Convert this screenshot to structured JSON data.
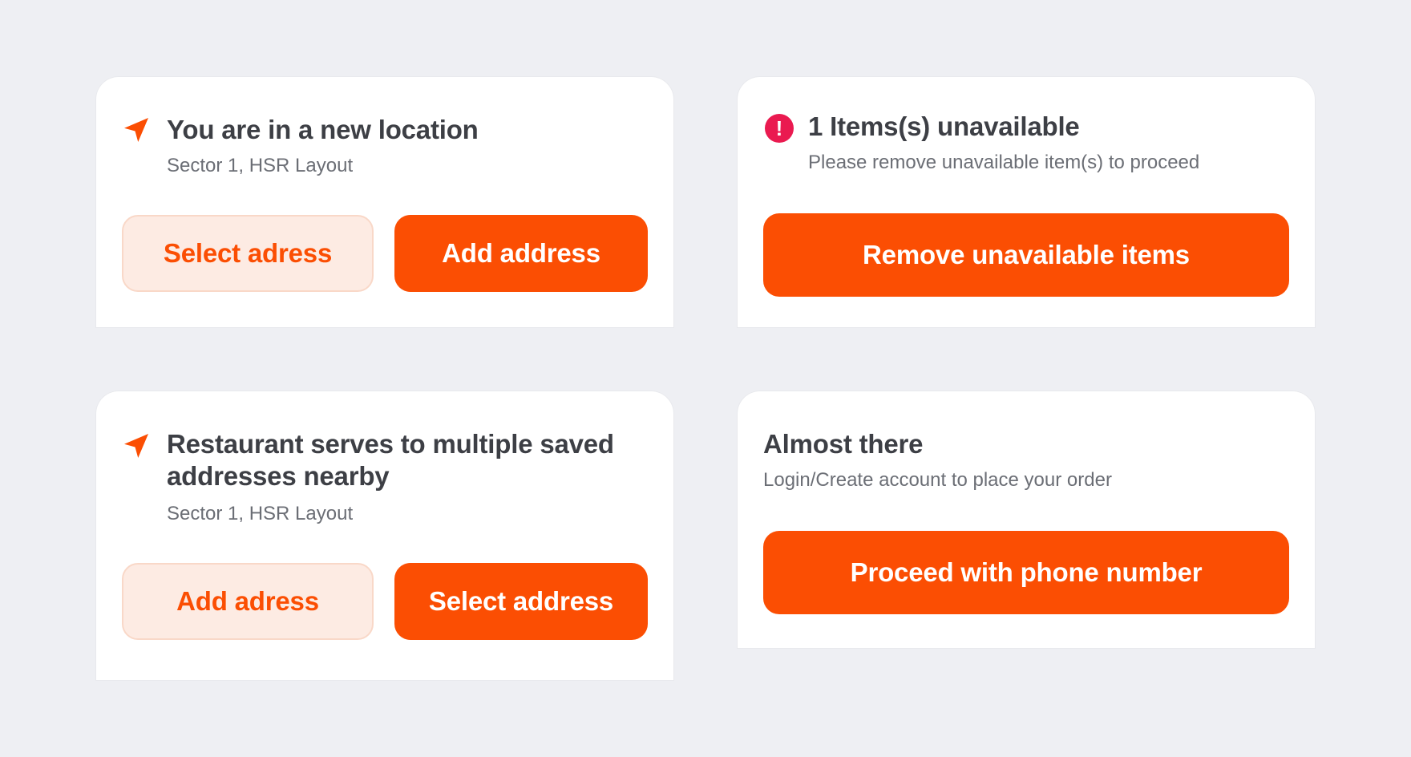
{
  "colors": {
    "background": "#eeeff3",
    "card": "#ffffff",
    "accent": "#fb4e03",
    "accent_light": "#fdebe3",
    "alert": "#ea1a50",
    "title_text": "#3d3f45",
    "subtitle_text": "#6b6e75"
  },
  "new_location": {
    "icon": "navigation-arrow-icon",
    "title": "You are in a new location",
    "subtitle": "Sector 1, HSR Layout",
    "secondary_button": "Select adress",
    "primary_button": "Add address"
  },
  "unavailable": {
    "icon": "alert-icon",
    "icon_glyph": "!",
    "title": "1 Items(s) unavailable",
    "subtitle": "Please remove unavailable item(s) to proceed",
    "primary_button": "Remove unavailable items"
  },
  "multiple_addresses": {
    "icon": "navigation-arrow-icon",
    "title_line1": "Restaurant serves to multiple saved",
    "title_line2": "addresses nearby",
    "subtitle": "Sector 1, HSR Layout",
    "secondary_button": "Add adress",
    "primary_button": "Select address"
  },
  "almost_there": {
    "title": "Almost there",
    "subtitle": "Login/Create account to place your order",
    "primary_button": "Proceed with phone number"
  }
}
